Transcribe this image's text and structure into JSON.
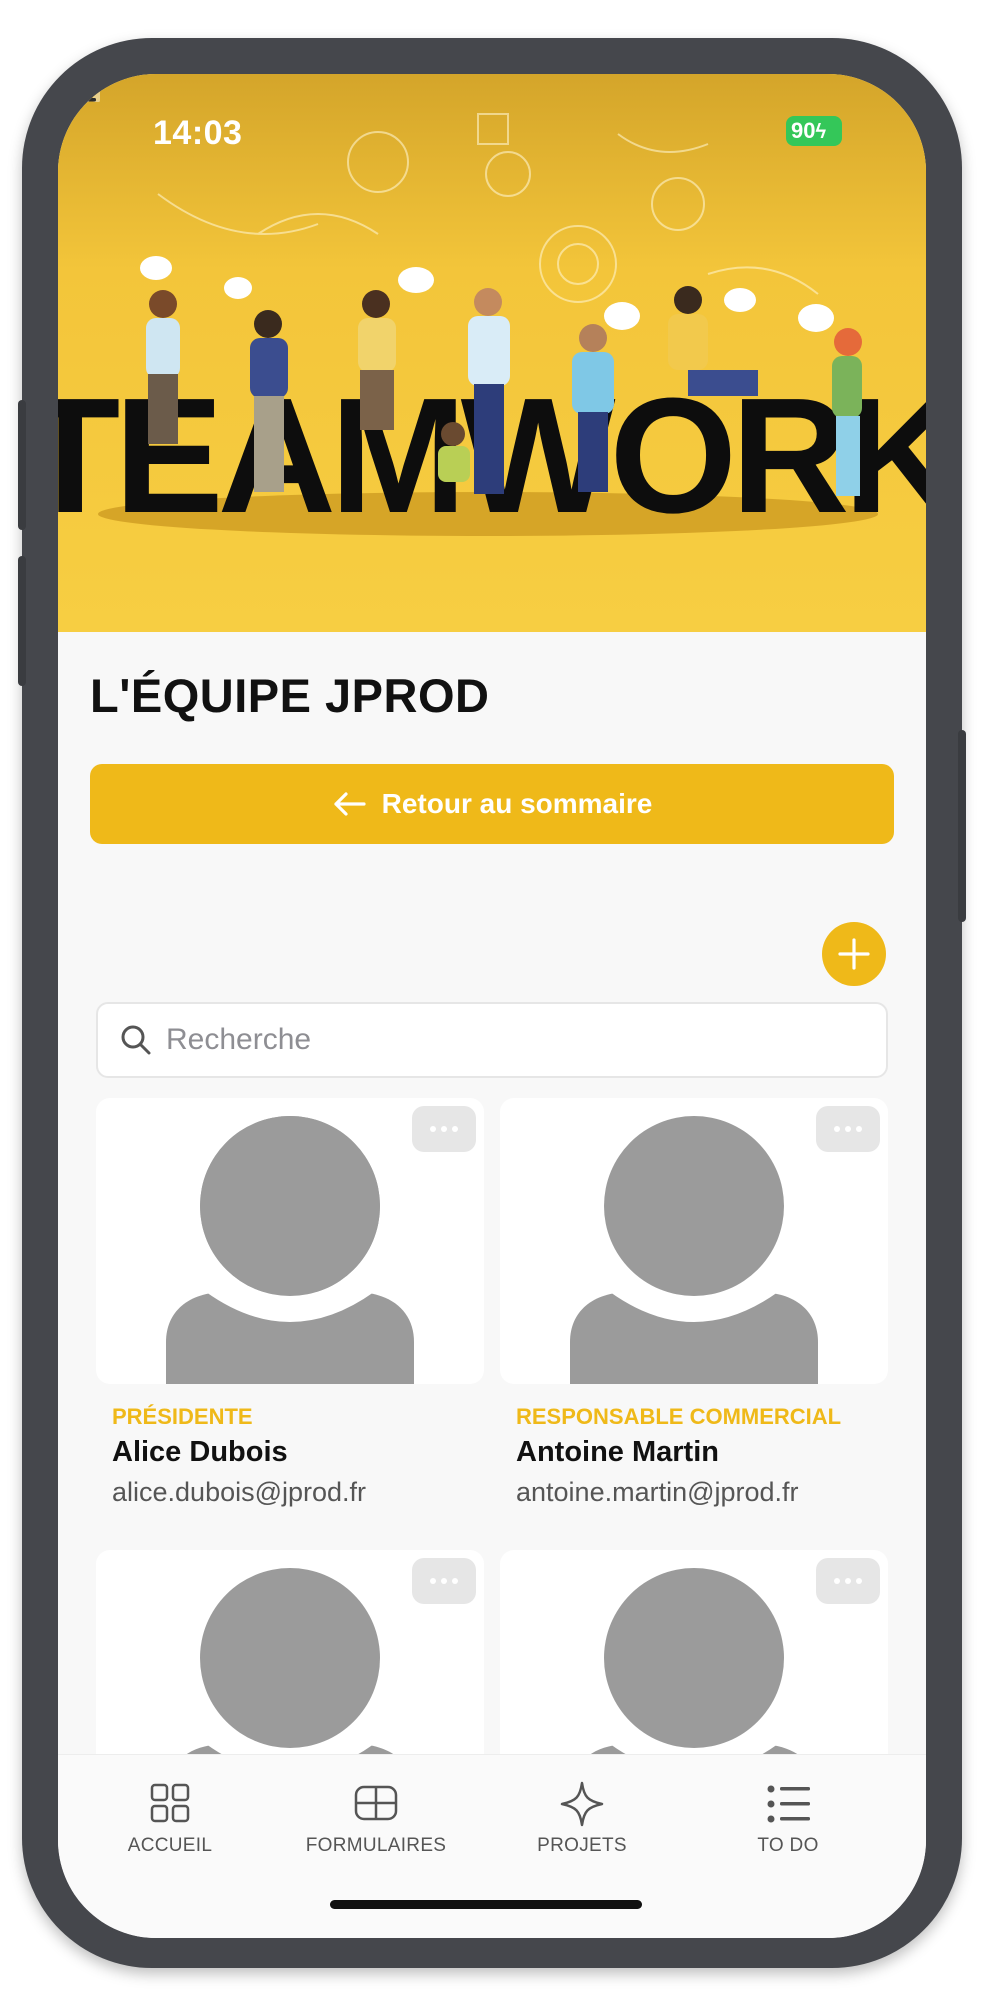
{
  "status_bar": {
    "time": "14:03",
    "battery": "90"
  },
  "hero": {
    "banner_text": "TEAMWORK"
  },
  "page": {
    "title": "L'ÉQUIPE JPROD"
  },
  "back_button": {
    "label": "Retour au sommaire"
  },
  "search": {
    "placeholder": "Recherche"
  },
  "members": [
    {
      "role": "PRÉSIDENTE",
      "name": "Alice Dubois",
      "email": "alice.dubois@jprod.fr"
    },
    {
      "role": "RESPONSABLE COMMERCIAL",
      "name": "Antoine Martin",
      "email": "antoine.martin@jprod.fr"
    },
    {
      "role": "",
      "name": "",
      "email": ""
    },
    {
      "role": "",
      "name": "",
      "email": ""
    }
  ],
  "tabs": [
    {
      "label": "ACCUEIL",
      "icon": "grid-icon"
    },
    {
      "label": "FORMULAIRES",
      "icon": "form-icon"
    },
    {
      "label": "PROJETS",
      "icon": "sparkle-icon"
    },
    {
      "label": "TO DO",
      "icon": "list-icon"
    }
  ],
  "colors": {
    "accent": "#efb919",
    "hero_bg": "#f5c838",
    "placeholder_gray": "#9b9b9b"
  }
}
